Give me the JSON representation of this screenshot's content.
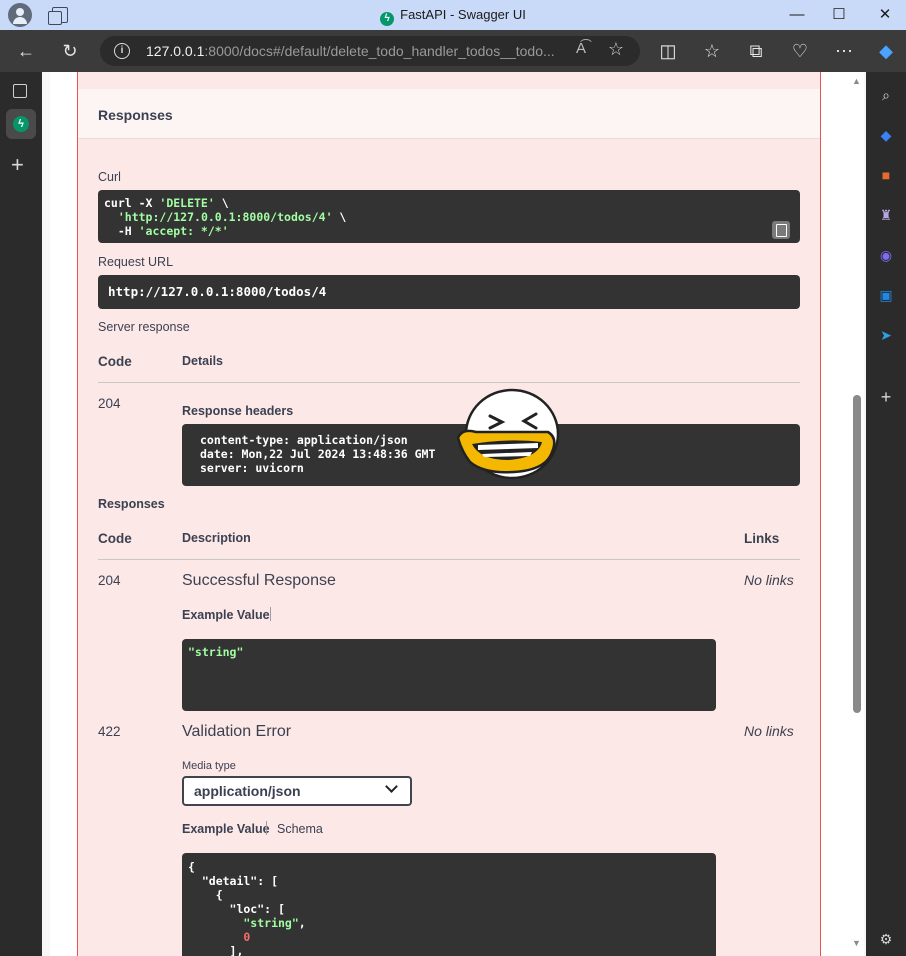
{
  "window": {
    "title": "FastAPI - Swagger UI"
  },
  "address_bar": {
    "url_host": "127.0.0.1",
    "url_rest": ":8000/docs#/default/delete_todo_handler_todos__todo..."
  },
  "responses_header": "Responses",
  "curl": {
    "label": "Curl",
    "line1_cmd": "curl -X ",
    "line1_method": "'DELETE'",
    "line1_end": " \\",
    "line2_url": "'http://127.0.0.1:8000/todos/4'",
    "line2_end": " \\",
    "line3_flag": "  -H ",
    "line3_value": "'accept: */*'"
  },
  "request_url": {
    "label": "Request URL",
    "value": "http://127.0.0.1:8000/todos/4"
  },
  "server_response": {
    "label": "Server response",
    "col_code": "Code",
    "col_details": "Details",
    "code": "204",
    "headers_label": "Response headers",
    "headers": [
      "content-type: application/json",
      "date: Mon,22 Jul 2024 13:48:36 GMT",
      "server: uvicorn"
    ]
  },
  "responses": {
    "label": "Responses",
    "col_code": "Code",
    "col_description": "Description",
    "col_links": "Links",
    "items": [
      {
        "code": "204",
        "description": "Successful Response",
        "links": "No links",
        "example_label": "Example Value",
        "example": "\"string\""
      },
      {
        "code": "422",
        "description": "Validation Error",
        "links": "No links",
        "media_type_label": "Media type",
        "media_type": "application/json",
        "example_label": "Example Value",
        "schema_label": "Schema"
      }
    ]
  },
  "validation_example": {
    "l1": "{",
    "l2_key": "  \"detail\"",
    "l2_rest": ": [",
    "l3": "    {",
    "l4_key": "      \"loc\"",
    "l4_rest": ": [",
    "l5_str": "        \"string\"",
    "l5_rest": ",",
    "l6_num": "        0",
    "l7": "      ],"
  }
}
